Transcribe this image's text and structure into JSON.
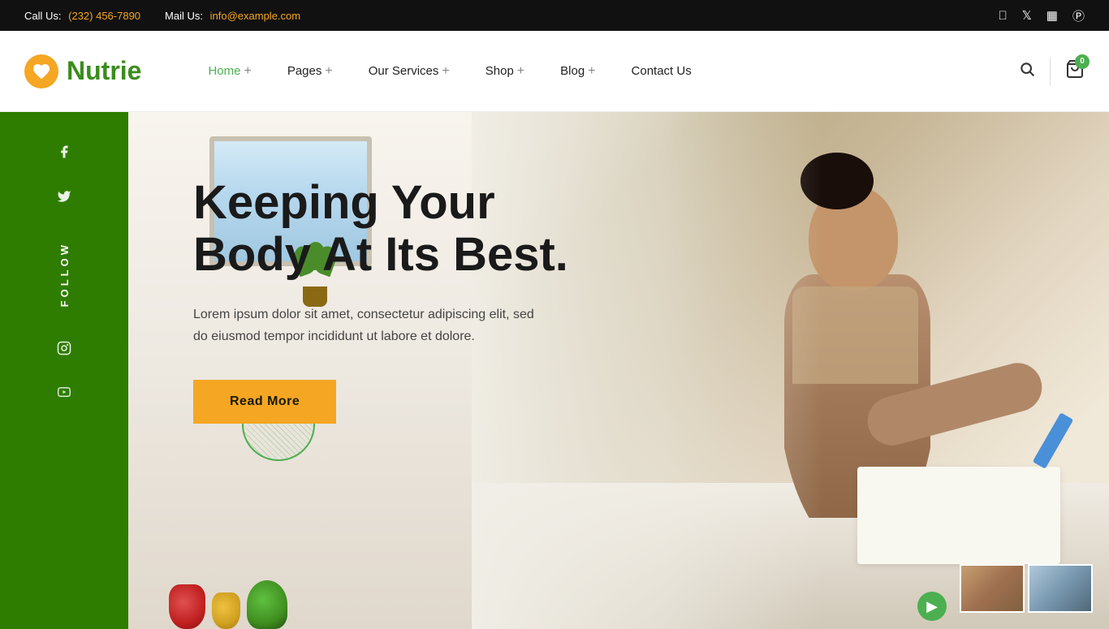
{
  "topbar": {
    "call_label": "Call Us:",
    "call_number": "(232) 456-7890",
    "mail_label": "Mail Us:",
    "mail_email": "info@example.com"
  },
  "header": {
    "logo_text": "Nutrie",
    "cart_count": "0",
    "nav": [
      {
        "label": "Home",
        "plus": "+",
        "active": true
      },
      {
        "label": "Pages",
        "plus": "+"
      },
      {
        "label": "Our Services",
        "plus": "+"
      },
      {
        "label": "Shop",
        "plus": "+"
      },
      {
        "label": "Blog",
        "plus": "+"
      },
      {
        "label": "Contact Us",
        "plus": ""
      }
    ]
  },
  "sidebar": {
    "follow_label": "FOLLOW",
    "socials": [
      "f",
      "t",
      "ig",
      "yt"
    ]
  },
  "hero": {
    "title_line1": "Keeping Your",
    "title_line2": "Body At Its Best.",
    "description": "Lorem ipsum dolor sit amet, consectetur adipiscing elit, sed do eiusmod tempor incididunt ut labore et dolore.",
    "read_more_label": "Read More"
  },
  "colors": {
    "green": "#4caf50",
    "dark_green": "#2e7d00",
    "orange": "#f5a623",
    "black": "#111111"
  }
}
